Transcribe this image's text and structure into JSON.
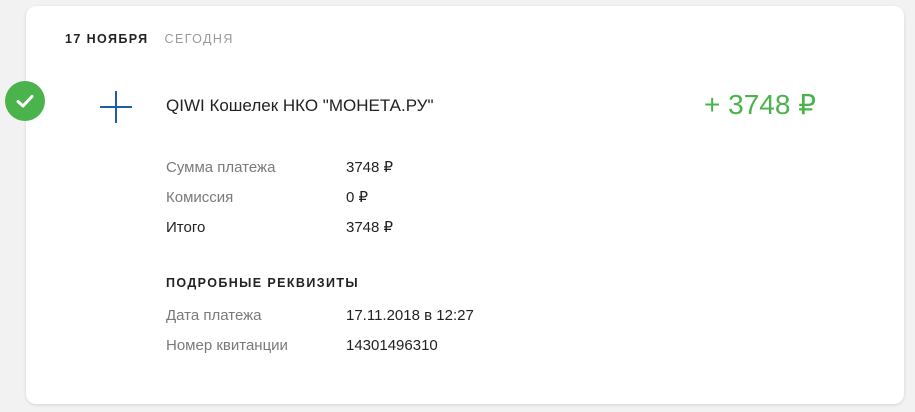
{
  "header": {
    "date": "17 НОЯБРЯ",
    "relative": "СЕГОДНЯ"
  },
  "transaction": {
    "status_icon": "check-icon",
    "type_icon": "plus-icon",
    "merchant": "QIWI Кошелек НКО \"МОНЕТА.РУ\"",
    "amount": "+ 3748 ₽",
    "amount_color": "#4bb34b"
  },
  "summary": [
    {
      "label": "Сумма платежа",
      "value": "3748 ₽"
    },
    {
      "label": "Комиссия",
      "value": "0 ₽"
    },
    {
      "label": "Итого",
      "value": "3748 ₽"
    }
  ],
  "requisites": {
    "title": "ПОДРОБНЫЕ РЕКВИЗИТЫ",
    "rows": [
      {
        "label": "Дата платежа",
        "value": "17.11.2018 в 12:27"
      },
      {
        "label": "Номер квитанции",
        "value": "14301496310"
      }
    ]
  }
}
